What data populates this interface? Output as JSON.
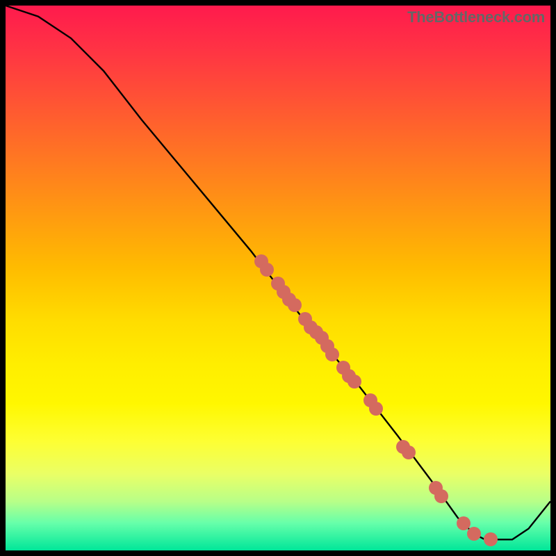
{
  "watermark": "TheBottleneck.com",
  "chart_data": {
    "type": "line",
    "title": "",
    "xlabel": "",
    "ylabel": "",
    "x_range": [
      0,
      100
    ],
    "y_range": [
      0,
      100
    ],
    "curve": [
      {
        "x": 0,
        "y": 100
      },
      {
        "x": 6,
        "y": 98
      },
      {
        "x": 12,
        "y": 94
      },
      {
        "x": 18,
        "y": 88
      },
      {
        "x": 25,
        "y": 79
      },
      {
        "x": 35,
        "y": 67
      },
      {
        "x": 45,
        "y": 55
      },
      {
        "x": 55,
        "y": 42
      },
      {
        "x": 65,
        "y": 30
      },
      {
        "x": 72,
        "y": 21
      },
      {
        "x": 78,
        "y": 13
      },
      {
        "x": 83,
        "y": 6
      },
      {
        "x": 86,
        "y": 3
      },
      {
        "x": 88,
        "y": 2
      },
      {
        "x": 93,
        "y": 2
      },
      {
        "x": 96,
        "y": 4
      },
      {
        "x": 100,
        "y": 9
      }
    ],
    "markers": [
      {
        "x": 47,
        "y": 53
      },
      {
        "x": 48,
        "y": 51.5
      },
      {
        "x": 50,
        "y": 49
      },
      {
        "x": 51,
        "y": 47.5
      },
      {
        "x": 52,
        "y": 46
      },
      {
        "x": 53,
        "y": 45
      },
      {
        "x": 55,
        "y": 42.5
      },
      {
        "x": 56,
        "y": 41
      },
      {
        "x": 57,
        "y": 40
      },
      {
        "x": 58,
        "y": 39
      },
      {
        "x": 59,
        "y": 37.5
      },
      {
        "x": 60,
        "y": 36
      },
      {
        "x": 62,
        "y": 33.5
      },
      {
        "x": 63,
        "y": 32
      },
      {
        "x": 64,
        "y": 31
      },
      {
        "x": 67,
        "y": 27.5
      },
      {
        "x": 68,
        "y": 26
      },
      {
        "x": 73,
        "y": 19
      },
      {
        "x": 74,
        "y": 18
      },
      {
        "x": 79,
        "y": 11.5
      },
      {
        "x": 80,
        "y": 10
      },
      {
        "x": 84,
        "y": 5
      },
      {
        "x": 86,
        "y": 3
      },
      {
        "x": 89,
        "y": 2
      }
    ],
    "gradient_stops": [
      {
        "pos": 0,
        "color": "#ff1a4d"
      },
      {
        "pos": 50,
        "color": "#ffdd00"
      },
      {
        "pos": 100,
        "color": "#00e699"
      }
    ]
  }
}
